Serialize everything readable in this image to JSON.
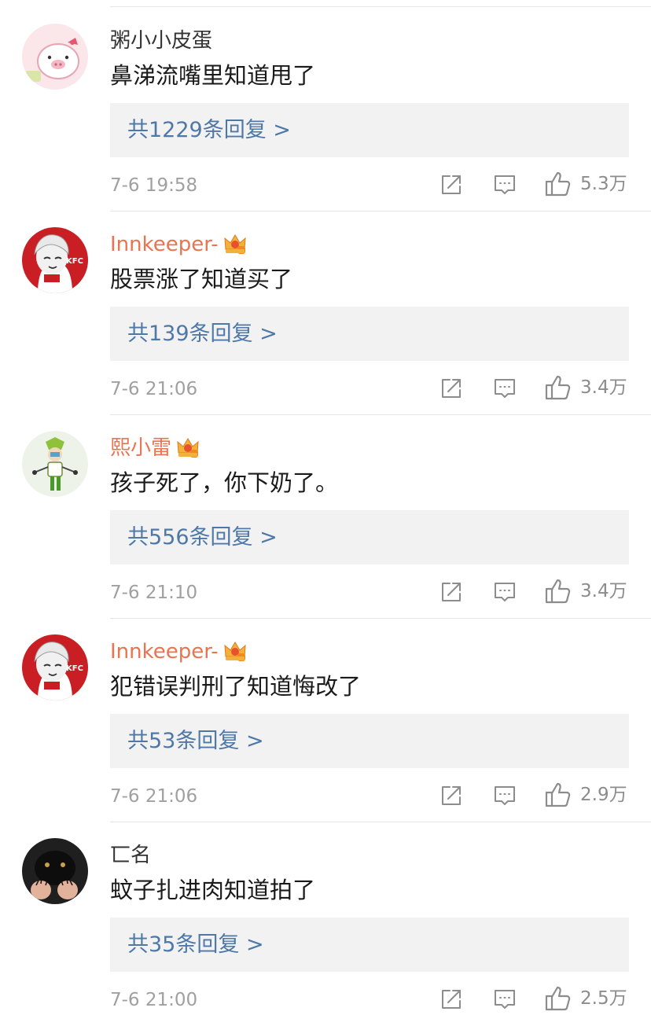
{
  "colors": {
    "vip_name": "#eb7350",
    "normal_name": "#333333",
    "reply_link": "#4e78a8",
    "meta_gray": "#a0a0a0"
  },
  "comments": [
    {
      "username": "粥小小皮蛋",
      "vip": false,
      "avatar_icon": "pig-avatar-icon",
      "text": "鼻涕流嘴里知道甩了",
      "replies": "共1229条回复 >",
      "time": "7-6 19:58",
      "likes": "5.3万"
    },
    {
      "username": "Innkeeper-",
      "vip": true,
      "vip_badge": "crown-icon",
      "avatar_icon": "anime-girl-kfc-avatar-icon",
      "text": "股票涨了知道买了",
      "replies": "共139条回复 >",
      "time": "7-6 21:06",
      "likes": "3.4万"
    },
    {
      "username": "熙小雷",
      "vip": true,
      "vip_badge": "crown-icon",
      "avatar_icon": "cartoon-character-avatar-icon",
      "text": "孩子死了，你下奶了。",
      "replies": "共556条回复 >",
      "time": "7-6 21:10",
      "likes": "3.4万"
    },
    {
      "username": "Innkeeper-",
      "vip": true,
      "vip_badge": "crown-icon",
      "avatar_icon": "anime-girl-kfc-avatar-icon",
      "text": "犯错误判刑了知道悔改了",
      "replies": "共53条回复 >",
      "time": "7-6 21:06",
      "likes": "2.9万"
    },
    {
      "username": "匸名",
      "vip": false,
      "avatar_icon": "cat-photo-avatar-icon",
      "text": "蚊子扎进肉知道拍了",
      "replies": "共35条回复 >",
      "time": "7-6 21:00",
      "likes": "2.5万"
    }
  ],
  "kfc_label": "KFC"
}
